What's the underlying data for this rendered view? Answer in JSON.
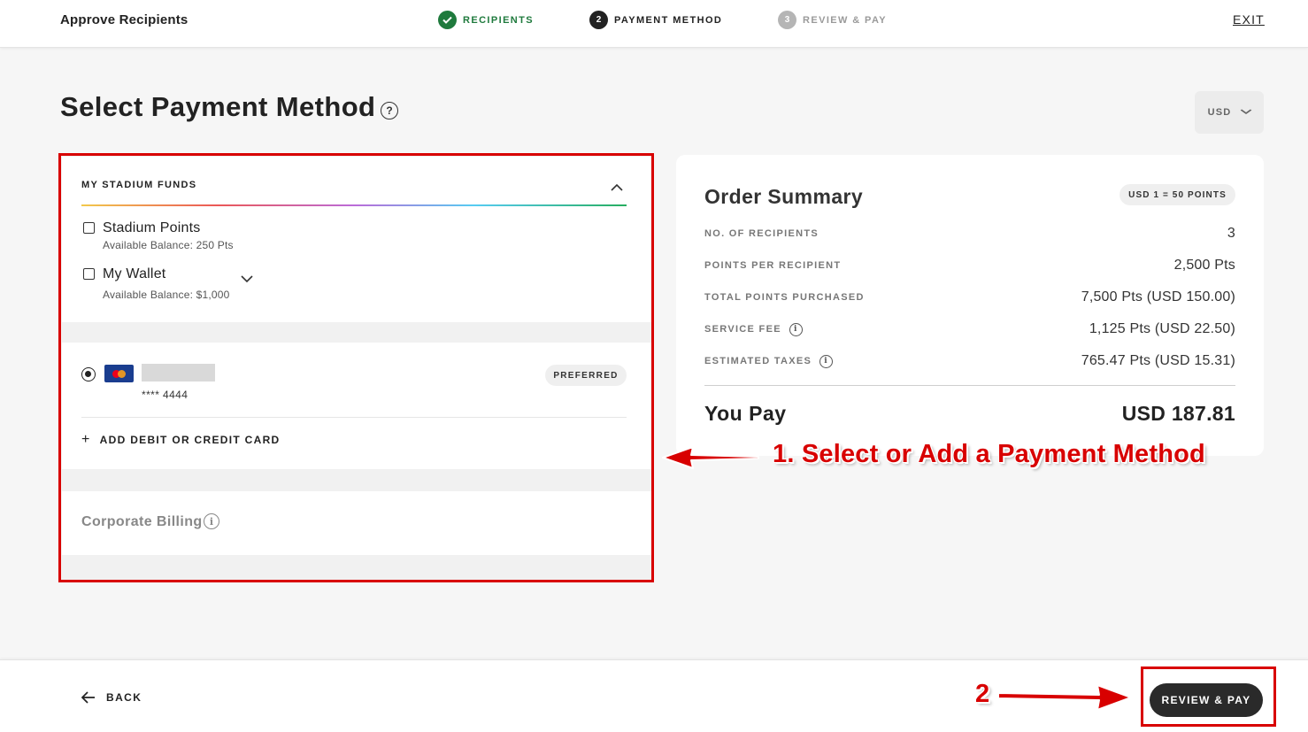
{
  "header": {
    "app_title": "Approve Recipients",
    "steps": [
      {
        "number": "✓",
        "label": "RECIPIENTS",
        "state": "done"
      },
      {
        "number": "2",
        "label": "PAYMENT METHOD",
        "state": "active"
      },
      {
        "number": "3",
        "label": "REVIEW & PAY",
        "state": "todo"
      }
    ],
    "exit_label": "EXIT"
  },
  "page": {
    "title": "Select Payment Method",
    "help_icon": "?",
    "currency": "USD"
  },
  "funds": {
    "header": "MY STADIUM FUNDS",
    "items": [
      {
        "name": "Stadium Points",
        "balance": "Available Balance: 250 Pts"
      },
      {
        "name": "My Wallet",
        "balance": "Available Balance: $1,000"
      }
    ]
  },
  "cards": {
    "saved_card_number": "**** 4444",
    "preferred_badge": "PREFERRED",
    "add_card_label": "ADD DEBIT OR CREDIT CARD",
    "add_icon": "+"
  },
  "corporate": {
    "label": "Corporate Billing",
    "info_icon": "i"
  },
  "summary": {
    "title": "Order Summary",
    "rate_badge": "USD 1 = 50 POINTS",
    "rows": [
      {
        "label": "NO. OF RECIPIENTS",
        "value": "3",
        "info": false
      },
      {
        "label": "POINTS PER RECIPIENT",
        "value": "2,500 Pts",
        "info": false
      },
      {
        "label": "TOTAL POINTS PURCHASED",
        "value": "7,500 Pts (USD 150.00)",
        "info": false
      },
      {
        "label": "SERVICE FEE",
        "value": "1,125 Pts (USD 22.50)",
        "info": true
      },
      {
        "label": "ESTIMATED TAXES",
        "value": "765.47 Pts (USD 15.31)",
        "info": true
      }
    ],
    "info_icon": "i",
    "you_pay_label": "You Pay",
    "you_pay_value": "USD 187.81"
  },
  "annotations": {
    "step1": "1. Select or Add a Payment Method",
    "step2": "2",
    "color": "#d80000"
  },
  "footer": {
    "back_label": "BACK",
    "review_button": "REVIEW & PAY"
  },
  "colors": {
    "success": "#1f7a3d",
    "dark": "#222222",
    "annotation_red": "#d80000"
  }
}
